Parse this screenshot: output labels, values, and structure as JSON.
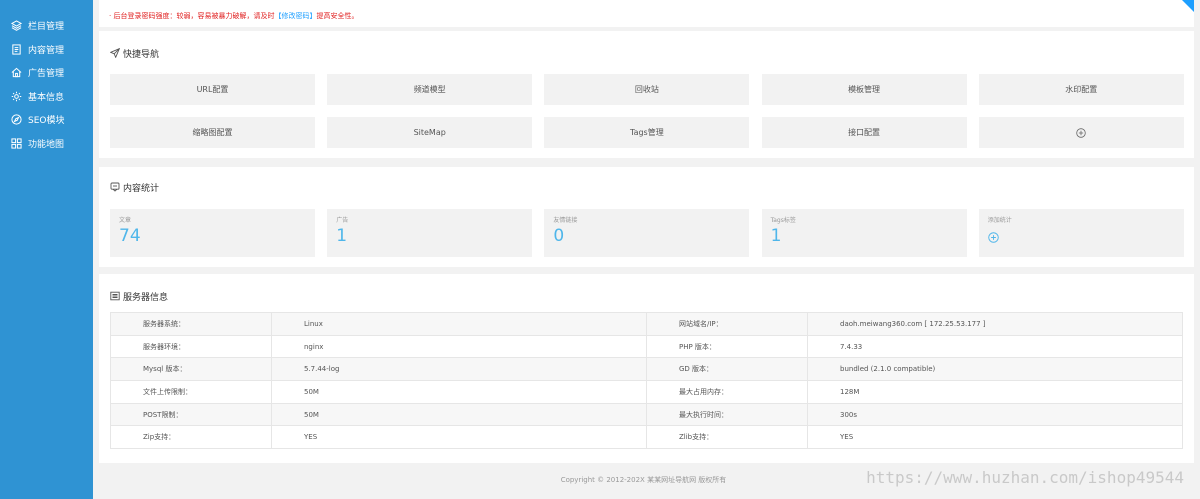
{
  "sidebar": {
    "items": [
      {
        "label": "栏目管理",
        "icon": "layers-icon"
      },
      {
        "label": "内容管理",
        "icon": "file-text-icon"
      },
      {
        "label": "广告管理",
        "icon": "home-icon"
      },
      {
        "label": "基本信息",
        "icon": "gear-icon"
      },
      {
        "label": "SEO模块",
        "icon": "compass-icon"
      },
      {
        "label": "功能地图",
        "icon": "grid-icon"
      }
    ]
  },
  "notice": {
    "prefix": "· 后台登录密码强度：较弱，容易被暴力破解，请及时",
    "link": "【修改密码】",
    "suffix": "提高安全性。"
  },
  "quick_nav": {
    "title": "快捷导航",
    "items": [
      "URL配置",
      "频道模型",
      "回收站",
      "模板管理",
      "水印配置",
      "缩略图配置",
      "SiteMap",
      "Tags管理",
      "接口配置"
    ],
    "add_icon": "plus-circle-icon"
  },
  "stats": {
    "title": "内容统计",
    "cards": [
      {
        "label": "文章",
        "value": "74"
      },
      {
        "label": "广告",
        "value": "1"
      },
      {
        "label": "友情链接",
        "value": "0"
      },
      {
        "label": "Tags标签",
        "value": "1"
      }
    ],
    "add_label": "添加统计"
  },
  "server": {
    "title": "服务器信息",
    "rows": [
      [
        "服务器系统：",
        "Linux",
        "网站域名/IP：",
        "daoh.meiwang360.com [ 172.25.53.177 ]"
      ],
      [
        "服务器环境：",
        "nginx",
        "PHP 版本：",
        "7.4.33"
      ],
      [
        "Mysql 版本：",
        "5.7.44-log",
        "GD 版本：",
        "bundled (2.1.0 compatible)"
      ],
      [
        "文件上传限制：",
        "50M",
        "最大占用内存：",
        "128M"
      ],
      [
        "POST限制：",
        "50M",
        "最大执行时间：",
        "300s"
      ],
      [
        "Zip支持：",
        "YES",
        "Zlib支持：",
        "YES"
      ]
    ]
  },
  "footer": {
    "text": "Copyright © 2012-202X 某某网址导航网 版权所有"
  },
  "watermark": "https://www.huzhan.com/ishop49544",
  "colors": {
    "sidebar": "#2f93d3",
    "accent": "#1e9fff",
    "warning": "#e02020",
    "stat_value": "#4fb6ea"
  }
}
